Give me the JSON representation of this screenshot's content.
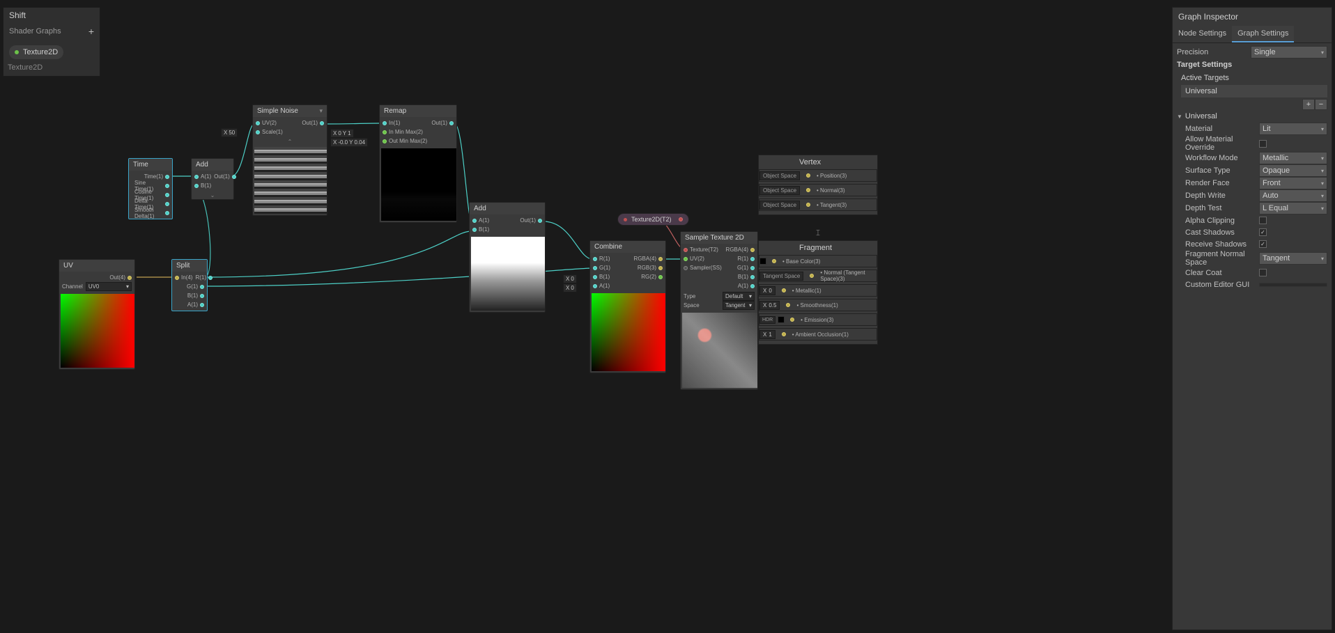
{
  "blackboard": {
    "title": "Shift",
    "category": "Shader Graphs",
    "add_label": "+",
    "props": [
      {
        "name": "Texture2D",
        "type": "Texture2D"
      }
    ]
  },
  "nodes": {
    "uv": {
      "title": "UV",
      "out_label": "Out(4)",
      "channel_label": "Channel",
      "channel_value": "UV0"
    },
    "time": {
      "title": "Time",
      "outputs": [
        "Time(1)",
        "Sine Time(1)",
        "Cosine Time(1)",
        "Delta Time(1)",
        "Smooth Delta(1)"
      ]
    },
    "split": {
      "title": "Split",
      "in_label": "In(4)",
      "outputs": [
        "R(1)",
        "G(1)",
        "B(1)",
        "A(1)"
      ]
    },
    "add1": {
      "title": "Add",
      "a_label": "A(1)",
      "b_label": "B(1)",
      "out_label": "Out(1)"
    },
    "noise": {
      "title": "Simple Noise",
      "uv_label": "UV(2)",
      "scale_label": "Scale(1)",
      "out_label": "Out(1)",
      "scale_value": "50",
      "scale_x": "X"
    },
    "remap": {
      "title": "Remap",
      "in_label": "In(1)",
      "inmin_label": "In Min Max(2)",
      "outmin_label": "Out Min Max(2)",
      "out_label": "Out(1)",
      "inmin": {
        "x": "0",
        "y": "1"
      },
      "outmin": {
        "x": "-0.0",
        "y": "0.04"
      }
    },
    "add2": {
      "title": "Add",
      "a_label": "A(1)",
      "b_label": "B(1)",
      "out_label": "Out(1)"
    },
    "combine": {
      "title": "Combine",
      "r_label": "R(1)",
      "g_label": "G(1)",
      "b_label": "B(1)",
      "a_label": "A(1)",
      "rgba_label": "RGBA(4)",
      "rgb_label": "RGB(3)",
      "rg_label": "RG(2)",
      "b_value": "0",
      "a_value": "0"
    },
    "prop_tex": {
      "label": "Texture2D(T2)"
    },
    "sample": {
      "title": "Sample Texture 2D",
      "tex_label": "Texture(T2)",
      "uv_label": "UV(2)",
      "sampler_label": "Sampler(SS)",
      "rgba_label": "RGBA(4)",
      "r_label": "R(1)",
      "g_label": "G(1)",
      "b_label": "B(1)",
      "a_label": "A(1)",
      "type_label": "Type",
      "type_value": "Default",
      "space_label": "Space",
      "space_value": "Tangent"
    }
  },
  "master": {
    "vertex": {
      "title": "Vertex",
      "rows": [
        {
          "space": "Object Space",
          "label": "Position(3)"
        },
        {
          "space": "Object Space",
          "label": "Normal(3)"
        },
        {
          "space": "Object Space",
          "label": "Tangent(3)"
        }
      ]
    },
    "fragment": {
      "title": "Fragment",
      "rows": [
        {
          "prefix_type": "swatch-black",
          "label": "Base Color(3)"
        },
        {
          "prefix_type": "space",
          "prefix": "Tangent Space",
          "label": "Normal (Tangent Space)(3)"
        },
        {
          "prefix_type": "float",
          "prefix": "0",
          "label": "Metallic(1)"
        },
        {
          "prefix_type": "float",
          "prefix": "0.5",
          "label": "Smoothness(1)"
        },
        {
          "prefix_type": "hdr",
          "prefix": "HDR",
          "label": "Emission(3)"
        },
        {
          "prefix_type": "float",
          "prefix": "1",
          "label": "Ambient Occlusion(1)"
        }
      ]
    }
  },
  "inspector": {
    "title": "Graph Inspector",
    "tabs": {
      "node": "Node Settings",
      "graph": "Graph Settings"
    },
    "precision_label": "Precision",
    "precision_value": "Single",
    "target_settings": "Target Settings",
    "active_targets": "Active Targets",
    "target": "Universal",
    "universal_fold": "Universal",
    "rows": [
      {
        "label": "Material",
        "type": "dropdown",
        "value": "Lit"
      },
      {
        "label": "Allow Material Override",
        "type": "checkbox",
        "value": false
      },
      {
        "label": "Workflow Mode",
        "type": "dropdown",
        "value": "Metallic"
      },
      {
        "label": "Surface Type",
        "type": "dropdown",
        "value": "Opaque"
      },
      {
        "label": "Render Face",
        "type": "dropdown",
        "value": "Front"
      },
      {
        "label": "Depth Write",
        "type": "dropdown",
        "value": "Auto"
      },
      {
        "label": "Depth Test",
        "type": "dropdown",
        "value": "L Equal"
      },
      {
        "label": "Alpha Clipping",
        "type": "checkbox",
        "value": false
      },
      {
        "label": "Cast Shadows",
        "type": "checkbox",
        "value": true
      },
      {
        "label": "Receive Shadows",
        "type": "checkbox",
        "value": true
      },
      {
        "label": "Fragment Normal Space",
        "type": "dropdown",
        "value": "Tangent"
      },
      {
        "label": "Clear Coat",
        "type": "checkbox",
        "value": false
      },
      {
        "label": "Custom Editor GUI",
        "type": "text",
        "value": ""
      }
    ]
  }
}
